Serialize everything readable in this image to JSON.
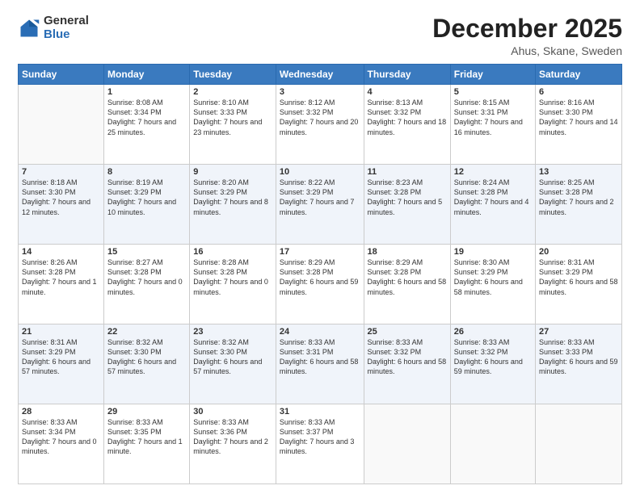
{
  "logo": {
    "general": "General",
    "blue": "Blue"
  },
  "header": {
    "title": "December 2025",
    "location": "Ahus, Skane, Sweden"
  },
  "days_of_week": [
    "Sunday",
    "Monday",
    "Tuesday",
    "Wednesday",
    "Thursday",
    "Friday",
    "Saturday"
  ],
  "weeks": [
    [
      {
        "day": "",
        "sunrise": "",
        "sunset": "",
        "daylight": ""
      },
      {
        "day": "1",
        "sunrise": "Sunrise: 8:08 AM",
        "sunset": "Sunset: 3:34 PM",
        "daylight": "Daylight: 7 hours and 25 minutes."
      },
      {
        "day": "2",
        "sunrise": "Sunrise: 8:10 AM",
        "sunset": "Sunset: 3:33 PM",
        "daylight": "Daylight: 7 hours and 23 minutes."
      },
      {
        "day": "3",
        "sunrise": "Sunrise: 8:12 AM",
        "sunset": "Sunset: 3:32 PM",
        "daylight": "Daylight: 7 hours and 20 minutes."
      },
      {
        "day": "4",
        "sunrise": "Sunrise: 8:13 AM",
        "sunset": "Sunset: 3:32 PM",
        "daylight": "Daylight: 7 hours and 18 minutes."
      },
      {
        "day": "5",
        "sunrise": "Sunrise: 8:15 AM",
        "sunset": "Sunset: 3:31 PM",
        "daylight": "Daylight: 7 hours and 16 minutes."
      },
      {
        "day": "6",
        "sunrise": "Sunrise: 8:16 AM",
        "sunset": "Sunset: 3:30 PM",
        "daylight": "Daylight: 7 hours and 14 minutes."
      }
    ],
    [
      {
        "day": "7",
        "sunrise": "Sunrise: 8:18 AM",
        "sunset": "Sunset: 3:30 PM",
        "daylight": "Daylight: 7 hours and 12 minutes."
      },
      {
        "day": "8",
        "sunrise": "Sunrise: 8:19 AM",
        "sunset": "Sunset: 3:29 PM",
        "daylight": "Daylight: 7 hours and 10 minutes."
      },
      {
        "day": "9",
        "sunrise": "Sunrise: 8:20 AM",
        "sunset": "Sunset: 3:29 PM",
        "daylight": "Daylight: 7 hours and 8 minutes."
      },
      {
        "day": "10",
        "sunrise": "Sunrise: 8:22 AM",
        "sunset": "Sunset: 3:29 PM",
        "daylight": "Daylight: 7 hours and 7 minutes."
      },
      {
        "day": "11",
        "sunrise": "Sunrise: 8:23 AM",
        "sunset": "Sunset: 3:28 PM",
        "daylight": "Daylight: 7 hours and 5 minutes."
      },
      {
        "day": "12",
        "sunrise": "Sunrise: 8:24 AM",
        "sunset": "Sunset: 3:28 PM",
        "daylight": "Daylight: 7 hours and 4 minutes."
      },
      {
        "day": "13",
        "sunrise": "Sunrise: 8:25 AM",
        "sunset": "Sunset: 3:28 PM",
        "daylight": "Daylight: 7 hours and 2 minutes."
      }
    ],
    [
      {
        "day": "14",
        "sunrise": "Sunrise: 8:26 AM",
        "sunset": "Sunset: 3:28 PM",
        "daylight": "Daylight: 7 hours and 1 minute."
      },
      {
        "day": "15",
        "sunrise": "Sunrise: 8:27 AM",
        "sunset": "Sunset: 3:28 PM",
        "daylight": "Daylight: 7 hours and 0 minutes."
      },
      {
        "day": "16",
        "sunrise": "Sunrise: 8:28 AM",
        "sunset": "Sunset: 3:28 PM",
        "daylight": "Daylight: 7 hours and 0 minutes."
      },
      {
        "day": "17",
        "sunrise": "Sunrise: 8:29 AM",
        "sunset": "Sunset: 3:28 PM",
        "daylight": "Daylight: 6 hours and 59 minutes."
      },
      {
        "day": "18",
        "sunrise": "Sunrise: 8:29 AM",
        "sunset": "Sunset: 3:28 PM",
        "daylight": "Daylight: 6 hours and 58 minutes."
      },
      {
        "day": "19",
        "sunrise": "Sunrise: 8:30 AM",
        "sunset": "Sunset: 3:29 PM",
        "daylight": "Daylight: 6 hours and 58 minutes."
      },
      {
        "day": "20",
        "sunrise": "Sunrise: 8:31 AM",
        "sunset": "Sunset: 3:29 PM",
        "daylight": "Daylight: 6 hours and 58 minutes."
      }
    ],
    [
      {
        "day": "21",
        "sunrise": "Sunrise: 8:31 AM",
        "sunset": "Sunset: 3:29 PM",
        "daylight": "Daylight: 6 hours and 57 minutes."
      },
      {
        "day": "22",
        "sunrise": "Sunrise: 8:32 AM",
        "sunset": "Sunset: 3:30 PM",
        "daylight": "Daylight: 6 hours and 57 minutes."
      },
      {
        "day": "23",
        "sunrise": "Sunrise: 8:32 AM",
        "sunset": "Sunset: 3:30 PM",
        "daylight": "Daylight: 6 hours and 57 minutes."
      },
      {
        "day": "24",
        "sunrise": "Sunrise: 8:33 AM",
        "sunset": "Sunset: 3:31 PM",
        "daylight": "Daylight: 6 hours and 58 minutes."
      },
      {
        "day": "25",
        "sunrise": "Sunrise: 8:33 AM",
        "sunset": "Sunset: 3:32 PM",
        "daylight": "Daylight: 6 hours and 58 minutes."
      },
      {
        "day": "26",
        "sunrise": "Sunrise: 8:33 AM",
        "sunset": "Sunset: 3:32 PM",
        "daylight": "Daylight: 6 hours and 59 minutes."
      },
      {
        "day": "27",
        "sunrise": "Sunrise: 8:33 AM",
        "sunset": "Sunset: 3:33 PM",
        "daylight": "Daylight: 6 hours and 59 minutes."
      }
    ],
    [
      {
        "day": "28",
        "sunrise": "Sunrise: 8:33 AM",
        "sunset": "Sunset: 3:34 PM",
        "daylight": "Daylight: 7 hours and 0 minutes."
      },
      {
        "day": "29",
        "sunrise": "Sunrise: 8:33 AM",
        "sunset": "Sunset: 3:35 PM",
        "daylight": "Daylight: 7 hours and 1 minute."
      },
      {
        "day": "30",
        "sunrise": "Sunrise: 8:33 AM",
        "sunset": "Sunset: 3:36 PM",
        "daylight": "Daylight: 7 hours and 2 minutes."
      },
      {
        "day": "31",
        "sunrise": "Sunrise: 8:33 AM",
        "sunset": "Sunset: 3:37 PM",
        "daylight": "Daylight: 7 hours and 3 minutes."
      },
      {
        "day": "",
        "sunrise": "",
        "sunset": "",
        "daylight": ""
      },
      {
        "day": "",
        "sunrise": "",
        "sunset": "",
        "daylight": ""
      },
      {
        "day": "",
        "sunrise": "",
        "sunset": "",
        "daylight": ""
      }
    ]
  ]
}
